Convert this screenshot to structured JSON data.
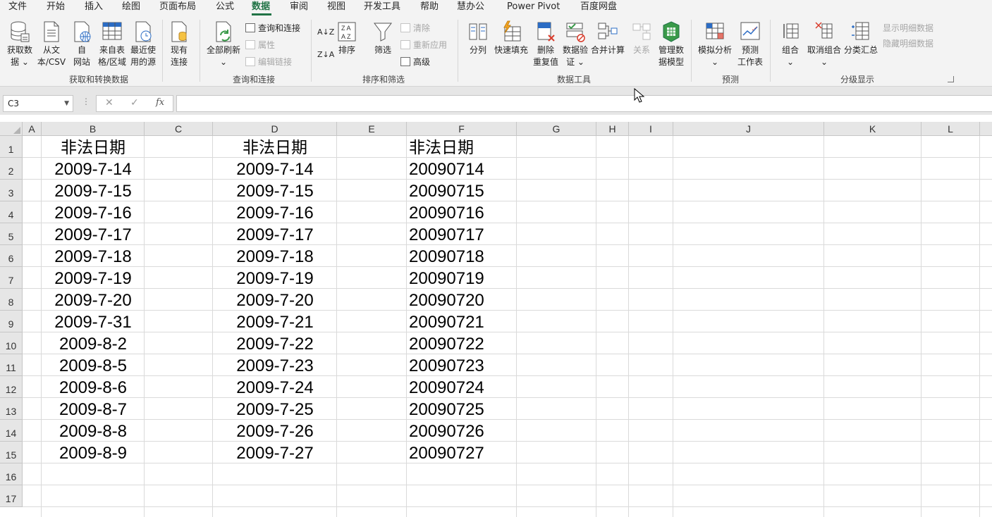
{
  "menu": [
    "文件",
    "开始",
    "插入",
    "绘图",
    "页面布局",
    "公式",
    "数据",
    "审阅",
    "视图",
    "开发工具",
    "帮助",
    "慧办公",
    "Power Pivot",
    "百度网盘"
  ],
  "active_menu": "数据",
  "ribbon": {
    "get_data": {
      "l1": "获取数",
      "l2": "据 ⌄"
    },
    "from_text": {
      "l1": "从文",
      "l2": "本/CSV"
    },
    "from_web": {
      "l1": "自",
      "l2": "网站"
    },
    "from_table": {
      "l1": "来自表",
      "l2": "格/区域"
    },
    "recent": {
      "l1": "最近使",
      "l2": "用的源"
    },
    "existing": {
      "l1": "现有",
      "l2": "连接"
    },
    "group1": "获取和转换数据",
    "refresh_all": {
      "l1": "全部刷新",
      "l2": "⌄"
    },
    "queries": "查询和连接",
    "properties": "属性",
    "edit_links": "编辑链接",
    "group2": "查询和连接",
    "sort_az": "A↓Z",
    "sort_za": "Z↓A",
    "sort": "排序",
    "filter": "筛选",
    "clear": "清除",
    "reapply": "重新应用",
    "advanced": "高级",
    "group3": "排序和筛选",
    "split": "分列",
    "flash_fill": "快速填充",
    "remove_dup": {
      "l1": "删除",
      "l2": "重复值"
    },
    "validation": {
      "l1": "数据验",
      "l2": "证 ⌄"
    },
    "consolidate": "合并计算",
    "relations": "关系",
    "data_model": {
      "l1": "管理数",
      "l2": "据模型"
    },
    "group4": "数据工具",
    "whatif": {
      "l1": "模拟分析",
      "l2": "⌄"
    },
    "forecast": {
      "l1": "预测",
      "l2": "工作表"
    },
    "group5": "预测",
    "group_btn": {
      "l1": "组合",
      "l2": "⌄"
    },
    "ungroup": {
      "l1": "取消组合",
      "l2": "⌄"
    },
    "subtotal": "分类汇总",
    "show_detail": "显示明细数据",
    "hide_detail": "隐藏明细数据",
    "group6": "分级显示"
  },
  "formula_bar": {
    "name_box": "C3",
    "dots": "⋮",
    "cancel": "✕",
    "enter": "✓",
    "fx": "fx",
    "formula": ""
  },
  "columns": [
    "A",
    "B",
    "C",
    "D",
    "E",
    "F",
    "G",
    "H",
    "I",
    "J",
    "K",
    "L"
  ],
  "rows": [
    "1",
    "2",
    "3",
    "4",
    "5",
    "6",
    "7",
    "8",
    "9",
    "10",
    "11",
    "12",
    "13",
    "14",
    "15",
    "16",
    "17"
  ],
  "colB": [
    "非法日期",
    "2009-7-14",
    "2009-7-15",
    "2009-7-16",
    "2009-7-17",
    "2009-7-18",
    "2009-7-19",
    "2009-7-20",
    "2009-7-31",
    "2009-8-2",
    "2009-8-5",
    "2009-8-6",
    "2009-8-7",
    "2009-8-8",
    "2009-8-9"
  ],
  "colD": [
    "非法日期",
    "2009-7-14",
    "2009-7-15",
    "2009-7-16",
    "2009-7-17",
    "2009-7-18",
    "2009-7-19",
    "2009-7-20",
    "2009-7-21",
    "2009-7-22",
    "2009-7-23",
    "2009-7-24",
    "2009-7-25",
    "2009-7-26",
    "2009-7-27"
  ],
  "colF": [
    "非法日期",
    "20090714",
    "20090715",
    "20090716",
    "20090717",
    "20090718",
    "20090719",
    "20090720",
    "20090721",
    "20090722",
    "20090723",
    "20090724",
    "20090725",
    "20090726",
    "20090727"
  ],
  "colors": {
    "accent": "#217346",
    "ribbon_bg": "#f3f3f3",
    "gridline": "#dadada",
    "header_bg": "#e6e6e6"
  }
}
